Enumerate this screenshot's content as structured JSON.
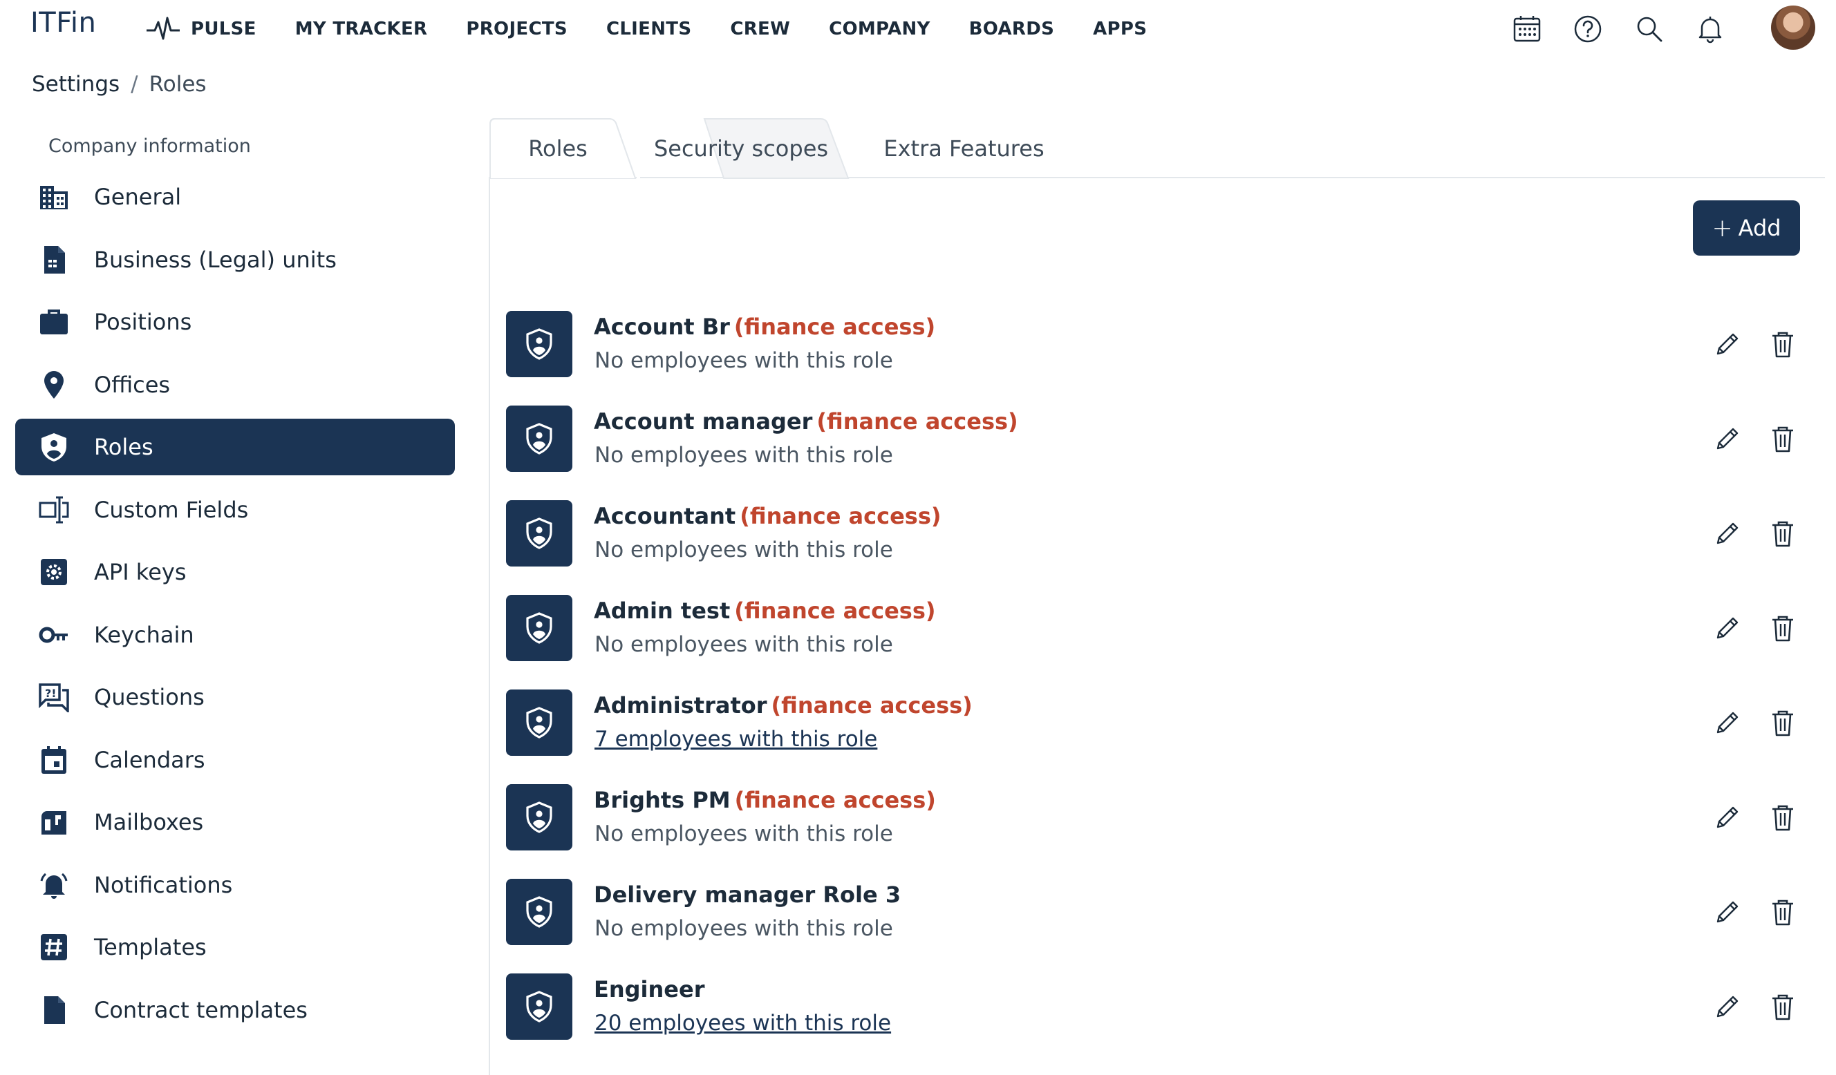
{
  "app": {
    "logo": "ITFin"
  },
  "nav": {
    "items": [
      {
        "label": "PULSE",
        "icon": "pulse-icon"
      },
      {
        "label": "MY TRACKER"
      },
      {
        "label": "PROJECTS"
      },
      {
        "label": "CLIENTS"
      },
      {
        "label": "CREW"
      },
      {
        "label": "COMPANY"
      },
      {
        "label": "BOARDS"
      },
      {
        "label": "APPS"
      }
    ],
    "right_icons": [
      "calendar-grid-icon",
      "help-icon",
      "search-icon",
      "bell-icon",
      "avatar"
    ]
  },
  "breadcrumb": {
    "root": "Settings",
    "separator": "/",
    "current": "Roles"
  },
  "sidebar": {
    "heading": "Company information",
    "items": [
      {
        "label": "General",
        "icon": "building-icon"
      },
      {
        "label": "Business (Legal) units",
        "icon": "document-icon"
      },
      {
        "label": "Positions",
        "icon": "briefcase-icon"
      },
      {
        "label": "Offices",
        "icon": "location-pin-icon"
      },
      {
        "label": "Roles",
        "icon": "shield-icon",
        "active": true
      },
      {
        "label": "Custom Fields",
        "icon": "custom-field-icon"
      },
      {
        "label": "API keys",
        "icon": "api-gear-icon"
      },
      {
        "label": "Keychain",
        "icon": "key-icon"
      },
      {
        "label": "Questions",
        "icon": "question-chat-icon"
      },
      {
        "label": "Calendars",
        "icon": "calendar-icon"
      },
      {
        "label": "Mailboxes",
        "icon": "mailbox-icon"
      },
      {
        "label": "Notifications",
        "icon": "bell-ring-icon"
      },
      {
        "label": "Templates",
        "icon": "hash-icon"
      },
      {
        "label": "Contract templates",
        "icon": "file-icon"
      }
    ]
  },
  "tabs": [
    {
      "label": "Roles",
      "active": true
    },
    {
      "label": "Security scopes"
    },
    {
      "label": "Extra Features"
    }
  ],
  "actions": {
    "add_label": "Add"
  },
  "roles": [
    {
      "name": "Account Br",
      "flag": "(finance access)",
      "subtitle": "No employees with this role",
      "is_link": false
    },
    {
      "name": "Account manager",
      "flag": "(finance access)",
      "subtitle": "No employees with this role",
      "is_link": false
    },
    {
      "name": "Accountant",
      "flag": "(finance access)",
      "subtitle": "No employees with this role",
      "is_link": false
    },
    {
      "name": "Admin test",
      "flag": "(finance access)",
      "subtitle": "No employees with this role",
      "is_link": false
    },
    {
      "name": "Administrator",
      "flag": "(finance access)",
      "subtitle": "7 employees with this role",
      "is_link": true
    },
    {
      "name": "Brights PM",
      "flag": "(finance access)",
      "subtitle": "No employees with this role",
      "is_link": false
    },
    {
      "name": "Delivery manager Role 3",
      "flag": "",
      "subtitle": "No employees with this role",
      "is_link": false
    },
    {
      "name": "Engineer",
      "flag": "",
      "subtitle": "20 employees with this role",
      "is_link": true
    }
  ],
  "colors": {
    "primary": "#1b3454",
    "finance_flag": "#c0452d",
    "text": "#1c2b3a",
    "muted": "#4a5662"
  }
}
